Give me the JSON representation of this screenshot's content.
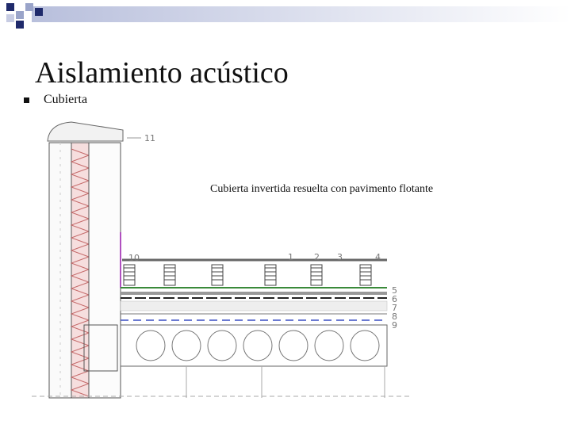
{
  "slide": {
    "title": "Aislamiento acústico",
    "bullet": "Cubierta",
    "caption": "Cubierta invertida resuelta con pavimento flotante"
  },
  "drawing": {
    "callouts": [
      "1",
      "2",
      "3",
      "4",
      "5",
      "6",
      "7",
      "8",
      "9",
      "10",
      "11"
    ]
  },
  "colors": {
    "deco_dark": "#1f2a6b",
    "deco_light": "#9aa4c9",
    "insulation": "#d9a0a0",
    "membrane": "#3a8a3a",
    "purple": "#b050c0"
  }
}
